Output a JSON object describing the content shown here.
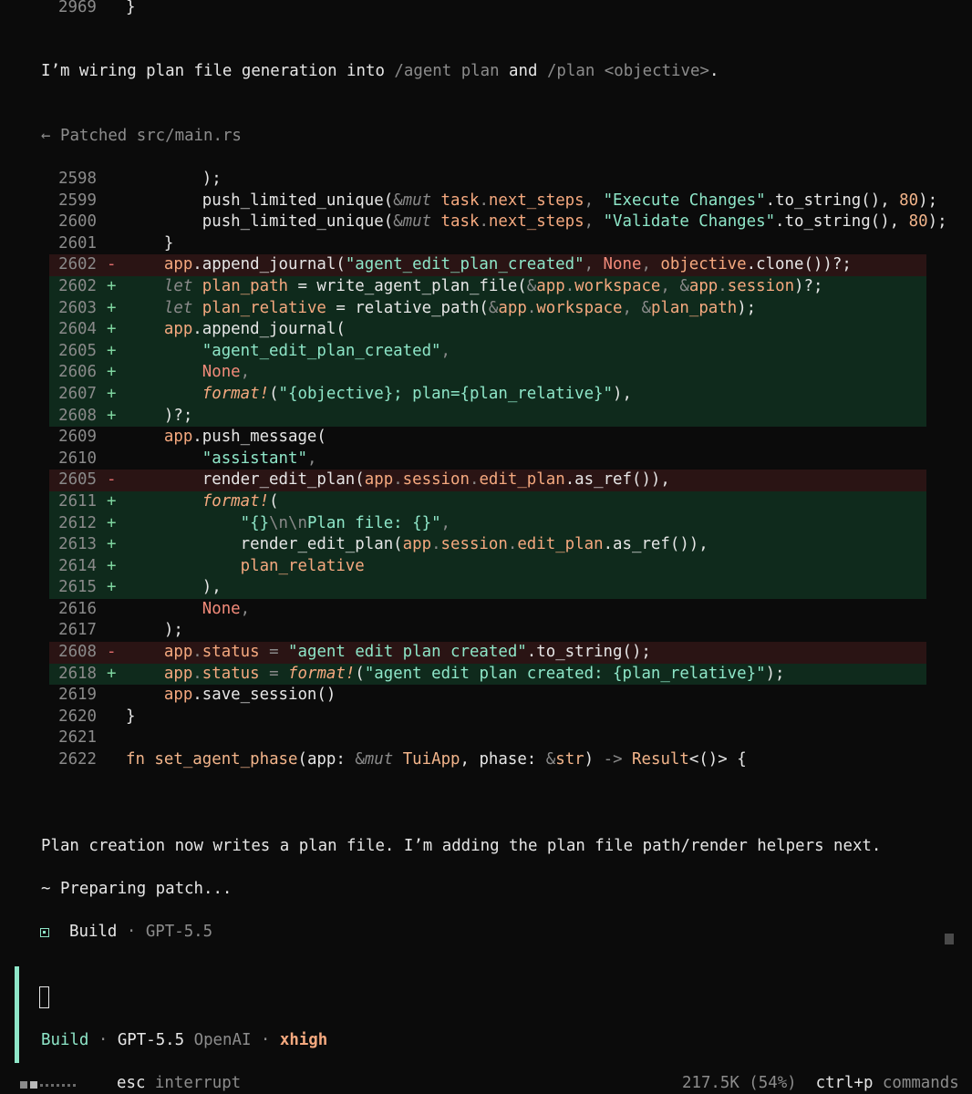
{
  "top": {
    "line_num": "2969",
    "brace": "}"
  },
  "msg1": {
    "part1": "I’m wiring plan file generation into ",
    "cmd1": "/agent plan",
    "and": " and ",
    "cmd2": "/plan <objective>",
    "end": "."
  },
  "patched": {
    "arrow": "←",
    "label": "Patched src/main.rs"
  },
  "diff": {
    "rows": [
      {
        "ln": "2598",
        "k": "ctx",
        "m": "",
        "seg": [
          [
            "        );",
            "w"
          ]
        ]
      },
      {
        "ln": "2599",
        "k": "ctx",
        "m": "",
        "seg": [
          [
            "        push_limited_unique(",
            "w"
          ],
          [
            "&",
            "g"
          ],
          [
            "mut",
            "gi"
          ],
          [
            " task",
            "o"
          ],
          [
            ".",
            "g"
          ],
          [
            "next_steps",
            "o"
          ],
          [
            ", ",
            "g"
          ],
          [
            "\"Execute Changes\"",
            "t"
          ],
          [
            ".to_string(), ",
            "w"
          ],
          [
            "80",
            "p"
          ],
          [
            ");",
            "w"
          ]
        ]
      },
      {
        "ln": "2600",
        "k": "ctx",
        "m": "",
        "seg": [
          [
            "        push_limited_unique(",
            "w"
          ],
          [
            "&",
            "g"
          ],
          [
            "mut",
            "gi"
          ],
          [
            " task",
            "o"
          ],
          [
            ".",
            "g"
          ],
          [
            "next_steps",
            "o"
          ],
          [
            ", ",
            "g"
          ],
          [
            "\"Validate Changes\"",
            "t"
          ],
          [
            ".to_string(), ",
            "w"
          ],
          [
            "80",
            "p"
          ],
          [
            ");",
            "w"
          ]
        ]
      },
      {
        "ln": "2601",
        "k": "ctx",
        "m": "",
        "seg": [
          [
            "    }",
            "w"
          ]
        ]
      },
      {
        "ln": "2602",
        "k": "del",
        "m": "-",
        "seg": [
          [
            "    app",
            "o"
          ],
          [
            ".append_journal(",
            "w"
          ],
          [
            "\"agent_edit_plan_created\"",
            "t"
          ],
          [
            ", ",
            "g"
          ],
          [
            "None",
            "r"
          ],
          [
            ", ",
            "g"
          ],
          [
            "objective",
            "o"
          ],
          [
            ".clone())?;",
            "w"
          ]
        ]
      },
      {
        "ln": "2602",
        "k": "add",
        "m": "+",
        "seg": [
          [
            "    ",
            "w"
          ],
          [
            "let",
            "gi"
          ],
          [
            " plan_path",
            "o"
          ],
          [
            " = write_agent_plan_file(",
            "w"
          ],
          [
            "&",
            "g"
          ],
          [
            "app",
            "o"
          ],
          [
            ".",
            "g"
          ],
          [
            "workspace",
            "o"
          ],
          [
            ", ",
            "g"
          ],
          [
            "&",
            "g"
          ],
          [
            "app",
            "o"
          ],
          [
            ".",
            "g"
          ],
          [
            "session",
            "o"
          ],
          [
            ")?;",
            "w"
          ]
        ]
      },
      {
        "ln": "2603",
        "k": "add",
        "m": "+",
        "seg": [
          [
            "    ",
            "w"
          ],
          [
            "let",
            "gi"
          ],
          [
            " plan_relative",
            "o"
          ],
          [
            " = relative_path(",
            "w"
          ],
          [
            "&",
            "g"
          ],
          [
            "app",
            "o"
          ],
          [
            ".",
            "g"
          ],
          [
            "workspace",
            "o"
          ],
          [
            ", ",
            "g"
          ],
          [
            "&",
            "g"
          ],
          [
            "plan_path",
            "o"
          ],
          [
            ");",
            "w"
          ]
        ]
      },
      {
        "ln": "2604",
        "k": "add",
        "m": "+",
        "seg": [
          [
            "    app",
            "o"
          ],
          [
            ".append_journal(",
            "w"
          ]
        ]
      },
      {
        "ln": "2605",
        "k": "add",
        "m": "+",
        "seg": [
          [
            "        ",
            "w"
          ],
          [
            "\"agent_edit_plan_created\"",
            "t"
          ],
          [
            ",",
            "g"
          ]
        ]
      },
      {
        "ln": "2606",
        "k": "add",
        "m": "+",
        "seg": [
          [
            "        ",
            "w"
          ],
          [
            "None",
            "r"
          ],
          [
            ",",
            "g"
          ]
        ]
      },
      {
        "ln": "2607",
        "k": "add",
        "m": "+",
        "seg": [
          [
            "        ",
            "w"
          ],
          [
            "format!",
            "oi"
          ],
          [
            "(",
            "w"
          ],
          [
            "\"{objective}; plan={plan_relative}\"",
            "t"
          ],
          [
            "),",
            "w"
          ]
        ]
      },
      {
        "ln": "2608",
        "k": "add",
        "m": "+",
        "seg": [
          [
            "    )?;",
            "w"
          ]
        ]
      },
      {
        "ln": "2609",
        "k": "ctx",
        "m": "",
        "seg": [
          [
            "    app",
            "o"
          ],
          [
            ".push_message(",
            "w"
          ]
        ]
      },
      {
        "ln": "2610",
        "k": "ctx",
        "m": "",
        "seg": [
          [
            "        ",
            "w"
          ],
          [
            "\"assistant\"",
            "t"
          ],
          [
            ",",
            "g"
          ]
        ]
      },
      {
        "ln": "2605",
        "k": "del",
        "m": "-",
        "seg": [
          [
            "        render_edit_plan(",
            "w"
          ],
          [
            "app",
            "o"
          ],
          [
            ".",
            "g"
          ],
          [
            "session",
            "o"
          ],
          [
            ".",
            "g"
          ],
          [
            "edit_plan",
            "o"
          ],
          [
            ".as_ref()),",
            "w"
          ]
        ]
      },
      {
        "ln": "2611",
        "k": "add",
        "m": "+",
        "seg": [
          [
            "        ",
            "w"
          ],
          [
            "format!",
            "oi"
          ],
          [
            "(",
            "w"
          ]
        ]
      },
      {
        "ln": "2612",
        "k": "add",
        "m": "+",
        "seg": [
          [
            "            ",
            "w"
          ],
          [
            "\"{}",
            "t"
          ],
          [
            "\\n\\n",
            "g"
          ],
          [
            "Plan file: {}\"",
            "t"
          ],
          [
            ",",
            "g"
          ]
        ]
      },
      {
        "ln": "2613",
        "k": "add",
        "m": "+",
        "seg": [
          [
            "            render_edit_plan(",
            "w"
          ],
          [
            "app",
            "o"
          ],
          [
            ".",
            "g"
          ],
          [
            "session",
            "o"
          ],
          [
            ".",
            "g"
          ],
          [
            "edit_plan",
            "o"
          ],
          [
            ".as_ref()),",
            "w"
          ]
        ]
      },
      {
        "ln": "2614",
        "k": "add",
        "m": "+",
        "seg": [
          [
            "            ",
            "w"
          ],
          [
            "plan_relative",
            "o"
          ]
        ]
      },
      {
        "ln": "2615",
        "k": "add",
        "m": "+",
        "seg": [
          [
            "        ),",
            "w"
          ]
        ]
      },
      {
        "ln": "2616",
        "k": "ctx",
        "m": "",
        "seg": [
          [
            "        ",
            "w"
          ],
          [
            "None",
            "r"
          ],
          [
            ",",
            "g"
          ]
        ]
      },
      {
        "ln": "2617",
        "k": "ctx",
        "m": "",
        "seg": [
          [
            "    );",
            "w"
          ]
        ]
      },
      {
        "ln": "2608",
        "k": "del",
        "m": "-",
        "seg": [
          [
            "    app",
            "o"
          ],
          [
            ".",
            "g"
          ],
          [
            "status",
            "o"
          ],
          [
            " = ",
            "g"
          ],
          [
            "\"agent edit plan created\"",
            "t"
          ],
          [
            ".to_string();",
            "w"
          ]
        ]
      },
      {
        "ln": "2618",
        "k": "add",
        "m": "+",
        "seg": [
          [
            "    app",
            "o"
          ],
          [
            ".",
            "g"
          ],
          [
            "status",
            "o"
          ],
          [
            " = ",
            "g"
          ],
          [
            "format!",
            "oi"
          ],
          [
            "(",
            "w"
          ],
          [
            "\"agent edit plan created: {plan_relative}\"",
            "t"
          ],
          [
            ");",
            "w"
          ]
        ]
      },
      {
        "ln": "2619",
        "k": "ctx",
        "m": "",
        "seg": [
          [
            "    app",
            "o"
          ],
          [
            ".save_session()",
            "w"
          ]
        ]
      },
      {
        "ln": "2620",
        "k": "ctx",
        "m": "",
        "seg": [
          [
            "}",
            "w"
          ]
        ]
      },
      {
        "ln": "2621",
        "k": "ctx",
        "m": "",
        "seg": [
          [
            "",
            "w"
          ]
        ]
      },
      {
        "ln": "2622",
        "k": "ctx",
        "m": "",
        "seg": [
          [
            "fn",
            "p"
          ],
          [
            " set_agent_phase",
            "p"
          ],
          [
            "(app: ",
            "w"
          ],
          [
            "&",
            "g"
          ],
          [
            "mut",
            "gi"
          ],
          [
            " TuiApp",
            "p"
          ],
          [
            ", phase: ",
            "w"
          ],
          [
            "&",
            "g"
          ],
          [
            "str",
            "p"
          ],
          [
            ") ",
            "w"
          ],
          [
            "->",
            "g"
          ],
          [
            " Result",
            "p"
          ],
          [
            "<()> {",
            "w"
          ]
        ]
      }
    ]
  },
  "msg2": "Plan creation now writes a plan file. I’m adding the plan file path/render helpers next.",
  "preparing": "~ Preparing patch...",
  "build_status": {
    "agent": "Build",
    "sep": "·",
    "model": "GPT-5.5"
  },
  "prompt": {
    "agent": "Build",
    "sep1": "·",
    "model": "GPT-5.5",
    "provider": "OpenAI",
    "sep2": "·",
    "effort": "xhigh"
  },
  "footer": {
    "esc_key": "esc",
    "esc_action": "interrupt",
    "tokens": "217.5K (54%)",
    "cmd_key": "ctrl+p",
    "cmd_action": "commands"
  },
  "colors": {
    "accent": "#8ee6c8",
    "orange": "#f5a97f",
    "del_bg": "#2a1414",
    "add_bg": "#0f2a1c"
  }
}
